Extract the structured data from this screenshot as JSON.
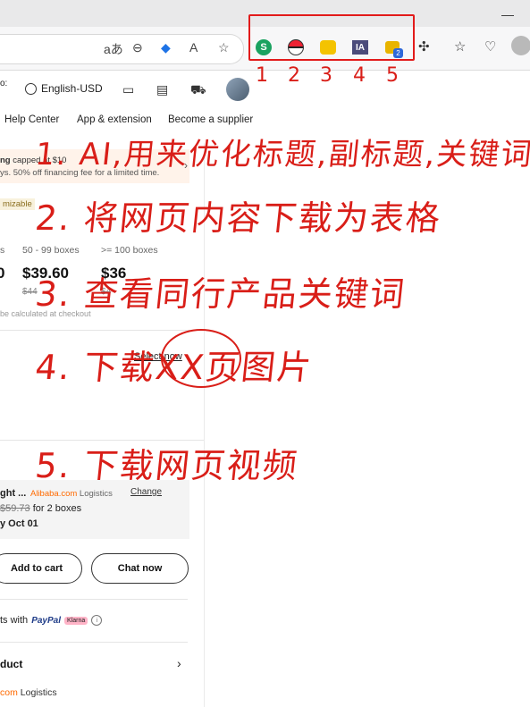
{
  "browser": {
    "toolbar_icons": [
      "read-aloud-icon",
      "zoom-out-icon",
      "tag-icon",
      "text-size-icon",
      "favorite-star-icon"
    ],
    "read_aloud_label": "aあ",
    "text_label": "A",
    "extensions": [
      {
        "name": "green-s-extension"
      },
      {
        "name": "pokeball-extension"
      },
      {
        "name": "pikachu-extension"
      },
      {
        "name": "ia-extension",
        "label": "IA"
      },
      {
        "name": "cat-extension",
        "badge": "2"
      }
    ],
    "extras": [
      "puzzle-icon",
      "favorites-icon",
      "heartbeat-icon",
      "profile-avatar"
    ]
  },
  "site_header": {
    "lang_label": "English-USD",
    "cut_text": "o:"
  },
  "nav": {
    "items": [
      "Help Center",
      "App & extension",
      "Become a supplier"
    ]
  },
  "promo": {
    "line1_bold": "ng",
    "line1_rest": " capped at $10",
    "line2": "ys. 50% off financing fee for a limited time."
  },
  "customizable": "mizable",
  "tiers": [
    {
      "label": "s",
      "price": "0",
      "old": ""
    },
    {
      "label": "50 - 99 boxes",
      "price": "$39.60",
      "old": "$44"
    },
    {
      "label": ">= 100 boxes",
      "price": "$36",
      "old": "$4"
    }
  ],
  "calc_note": "be calculated at checkout",
  "select_now": "Select now",
  "shipping": {
    "title": "ght ...",
    "brand": "Alibaba.com",
    "brand_sub": " Logistics",
    "change": "Change",
    "old_price": "$59.73",
    "price_rest": " for 2 boxes",
    "date": "y Oct 01"
  },
  "buttons": {
    "add_to_cart": "Add to cart",
    "chat_now": "Chat now"
  },
  "payment": {
    "prefix": "ts with",
    "paypal": "PayPal",
    "klarna": "Klarna",
    "info": "i"
  },
  "product_label": "duct",
  "logistics": {
    "brand": "com",
    "rest": " Logistics"
  },
  "annotations": {
    "numbers": [
      "1",
      "2",
      "3",
      "4",
      "5"
    ],
    "notes": [
      "1. AI,用来优化标题,副标题,关键词",
      "2. 将网页内容下载为表格",
      "3. 查看同行产品关键词",
      "4. 下载XX页图片",
      "5. 下载网页视频"
    ],
    "circled_text": "XX",
    "color": "#d91e18"
  }
}
